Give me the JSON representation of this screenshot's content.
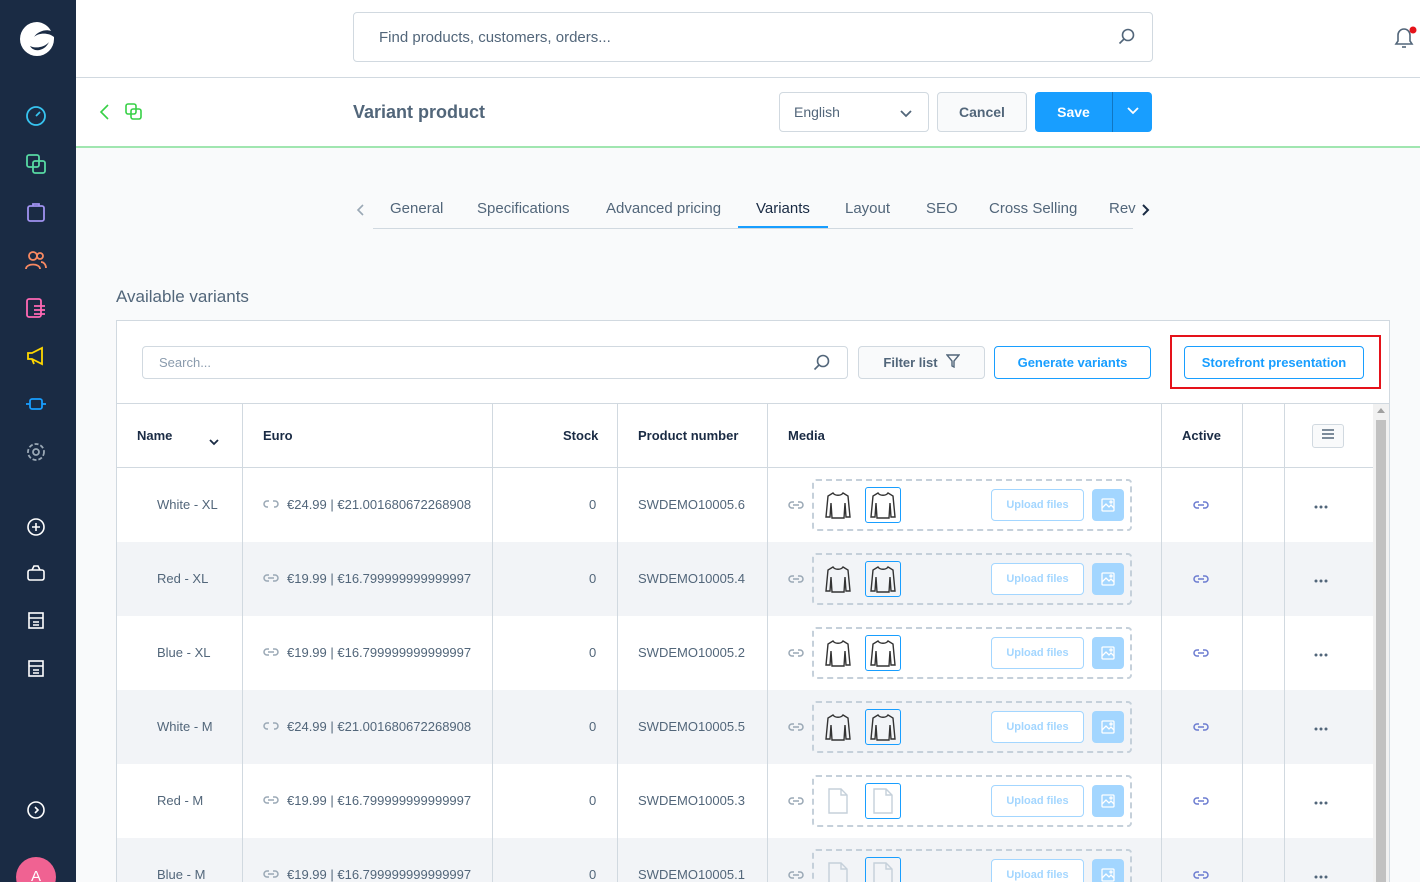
{
  "colors": {
    "sidebar": "#1a2b44",
    "accent": "#189eff",
    "highlight": "#e5121a",
    "avatar": "#f06292"
  },
  "topbar": {
    "search_placeholder": "Find products, customers, orders..."
  },
  "smartbar": {
    "title": "Variant product",
    "language": "English",
    "cancel_label": "Cancel",
    "save_label": "Save"
  },
  "sidebar": {
    "avatar_initial": "A",
    "icons": [
      "dashboard-icon",
      "catalog-icon",
      "orders-icon",
      "customers-icon",
      "content-icon",
      "marketing-icon",
      "extensions-icon",
      "settings-icon",
      "add-icon",
      "sales-channel-icon",
      "storefront-icon",
      "headless-icon",
      "help-icon"
    ]
  },
  "tabs": [
    "General",
    "Specifications",
    "Advanced pricing",
    "Variants",
    "Layout",
    "SEO",
    "Cross Selling",
    "Rev"
  ],
  "active_tab": "Variants",
  "section_title": "Available variants",
  "toolbar": {
    "search_placeholder": "Search...",
    "filter_label": "Filter list",
    "generate_label": "Generate variants",
    "storefront_label": "Storefront presentation"
  },
  "grid": {
    "headers": {
      "name": "Name",
      "euro": "Euro",
      "stock": "Stock",
      "product_number": "Product number",
      "media": "Media",
      "active": "Active"
    },
    "upload_label": "Upload files",
    "rows": [
      {
        "name": "White - XL",
        "price": "€24.99 | €21.001680672268908",
        "stock": "0",
        "number": "SWDEMO10005.6",
        "price_inherited": false,
        "media": "shirt"
      },
      {
        "name": "Red - XL",
        "price": "€19.99 | €16.799999999999997",
        "stock": "0",
        "number": "SWDEMO10005.4",
        "price_inherited": true,
        "media": "shirt"
      },
      {
        "name": "Blue - XL",
        "price": "€19.99 | €16.799999999999997",
        "stock": "0",
        "number": "SWDEMO10005.2",
        "price_inherited": true,
        "media": "shirt"
      },
      {
        "name": "White - M",
        "price": "€24.99 | €21.001680672268908",
        "stock": "0",
        "number": "SWDEMO10005.5",
        "price_inherited": false,
        "media": "shirt"
      },
      {
        "name": "Red - M",
        "price": "€19.99 | €16.799999999999997",
        "stock": "0",
        "number": "SWDEMO10005.3",
        "price_inherited": true,
        "media": "file"
      },
      {
        "name": "Blue - M",
        "price": "€19.99 | €16.799999999999997",
        "stock": "0",
        "number": "SWDEMO10005.1",
        "price_inherited": true,
        "media": "file"
      }
    ]
  }
}
